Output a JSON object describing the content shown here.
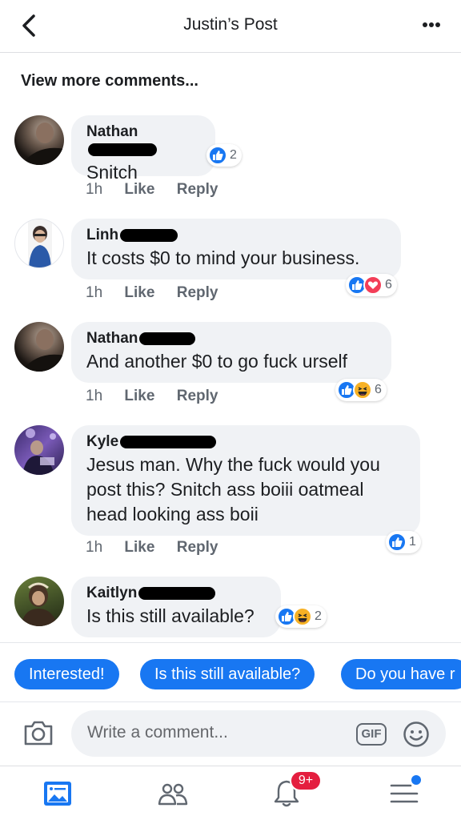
{
  "header": {
    "title": "Justin’s Post"
  },
  "view_more": "View more comments...",
  "comments": [
    {
      "name": "Nathan",
      "text": "Snitch",
      "time": "1h",
      "like": "Like",
      "reply": "Reply",
      "reaction_count": "2",
      "reactions": [
        "like"
      ]
    },
    {
      "name": "Linh",
      "text": "It costs $0 to mind your business.",
      "time": "1h",
      "like": "Like",
      "reply": "Reply",
      "reaction_count": "6",
      "reactions": [
        "like",
        "love"
      ]
    },
    {
      "name": "Nathan",
      "text": "And another $0 to go fuck urself",
      "time": "1h",
      "like": "Like",
      "reply": "Reply",
      "reaction_count": "6",
      "reactions": [
        "like",
        "haha"
      ]
    },
    {
      "name": "Kyle",
      "text": "Jesus man. Why the fuck would you post this? Snitch ass boiii oatmeal head looking ass boii",
      "time": "1h",
      "like": "Like",
      "reply": "Reply",
      "reaction_count": "1",
      "reactions": [
        "like"
      ]
    },
    {
      "name": "Kaitlyn",
      "text": "Is this still available?",
      "reaction_count": "2",
      "reactions": [
        "like",
        "haha"
      ]
    }
  ],
  "quick_replies": [
    "Interested!",
    "Is this still available?",
    "Do you have r"
  ],
  "composer": {
    "placeholder": "Write a comment...",
    "gif_label": "GIF"
  },
  "tabbar": {
    "notification_badge": "9+"
  },
  "colors": {
    "accent": "#1877f2",
    "badge": "#e41e3f",
    "bubble": "#f0f2f5"
  }
}
